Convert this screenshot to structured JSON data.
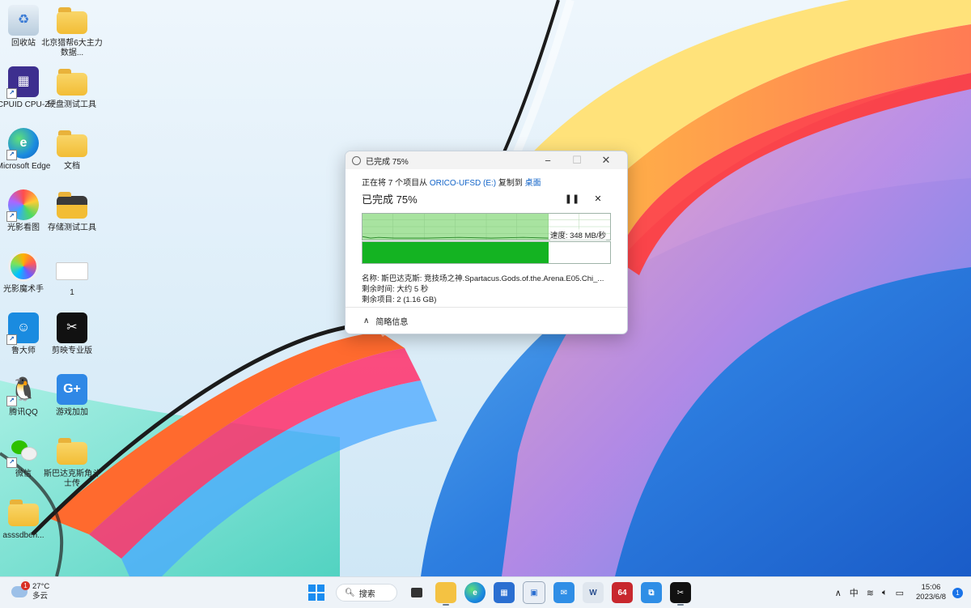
{
  "desktop": {
    "icons": [
      {
        "label": "回收站"
      },
      {
        "label": "北京猎帮6大主力数据..."
      },
      {
        "label": "CPUID CPU-Z"
      },
      {
        "label": "硬盘测试工具"
      },
      {
        "label": "Microsoft Edge"
      },
      {
        "label": "文档"
      },
      {
        "label": "光影看图"
      },
      {
        "label": "存储测试工具"
      },
      {
        "label": "光影魔术手"
      },
      {
        "label": "1"
      },
      {
        "label": "鲁大师"
      },
      {
        "label": "剪映专业版"
      },
      {
        "label": "腾讯QQ"
      },
      {
        "label": "游戏加加"
      },
      {
        "label": "微信"
      },
      {
        "label": "斯巴达克斯角斗士传"
      },
      {
        "label": "asssdben..."
      }
    ]
  },
  "dialog": {
    "window_title": "已完成 75%",
    "copy_prefix": "正在将 7 个项目从",
    "source": "ORICO-UFSD (E:)",
    "copy_mid": "复制到",
    "destination": "桌面",
    "percent_text": "已完成 75%",
    "progress": 0.75,
    "speed": "速度: 348 MB/秒",
    "name_line": "名称: 斯巴达克斯: 竞技场之神.Spartacus.Gods.of.the.Arena.E05.Chi_...",
    "time_line": "剩余时间: 大约 5 秒",
    "items_line": "剩余项目: 2 (1.16 GB)",
    "footer_label": "简略信息",
    "pause_icon": "pause-icon",
    "cancel_icon": "close-icon"
  },
  "taskbar": {
    "weather_temp": "27°C",
    "weather_desc": "多云",
    "weather_badge": "1",
    "search_label": "搜索",
    "ime": "中",
    "time": "15:06",
    "date": "2023/6/8",
    "notification_count": "1",
    "app_64_label": "64"
  },
  "colors": {
    "progress_light": "#a8e3a0",
    "progress_dark": "#14b322",
    "accent": "#1264c8"
  }
}
